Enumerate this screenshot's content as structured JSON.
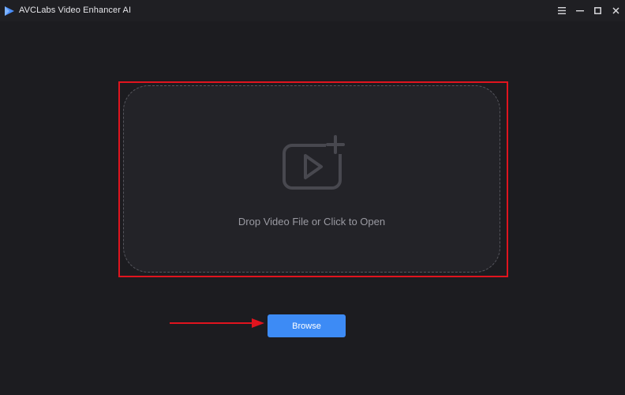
{
  "window": {
    "title": "AVCLabs Video Enhancer AI",
    "controls": [
      "menu-icon",
      "minimize-icon",
      "maximize-icon",
      "close-icon"
    ]
  },
  "dropzone": {
    "label": "Drop Video File or Click to Open",
    "icon": "video-add-icon"
  },
  "actions": {
    "browse_label": "Browse"
  },
  "annotations": {
    "highlight_color": "#e0141e",
    "arrow_color": "#e0141e"
  },
  "colors": {
    "background": "#1c1c20",
    "dropzone_fill": "#232328",
    "accent": "#3d8bf5"
  }
}
